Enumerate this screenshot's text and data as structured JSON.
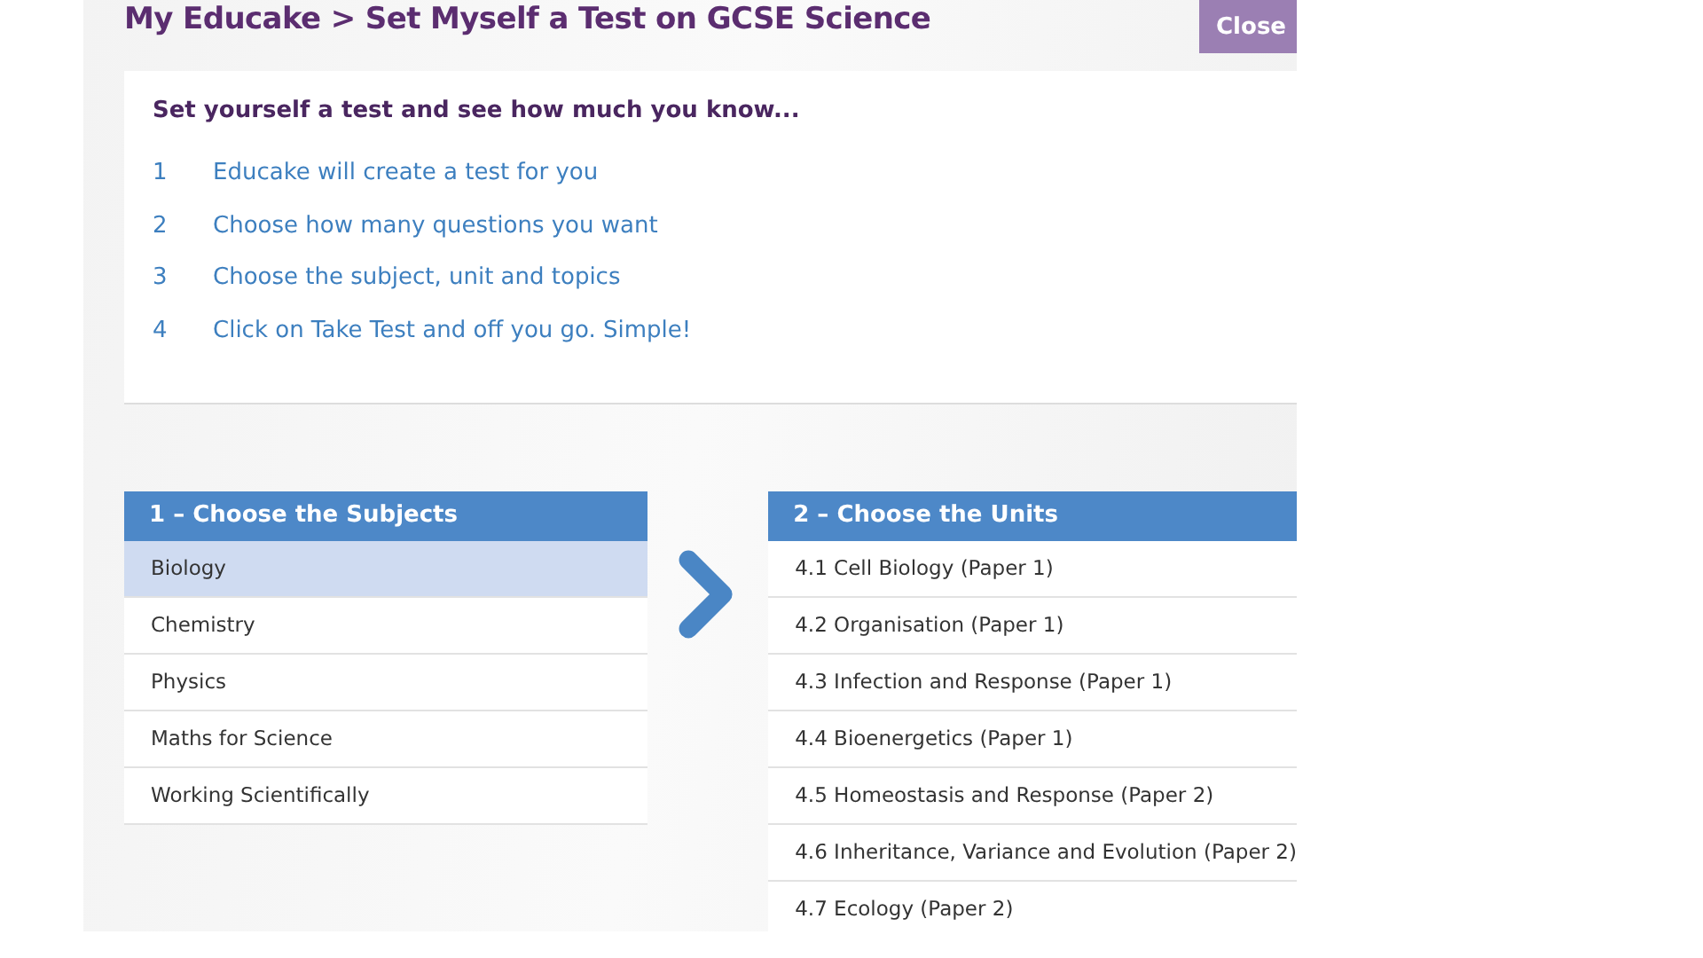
{
  "header": {
    "breadcrumb": "My Educake > Set Myself a Test on GCSE Science",
    "close_button": "Close"
  },
  "intro": {
    "heading": "Set yourself a test and see how much you know...",
    "steps": [
      {
        "number": "1",
        "text": "Educake will create a test for you"
      },
      {
        "number": "2",
        "text": "Choose how many questions you want"
      },
      {
        "number": "3",
        "text": "Choose the subject, unit and topics"
      },
      {
        "number": "4",
        "text": "Click on Take Test and off you go. Simple!"
      }
    ]
  },
  "subjects": {
    "title": "1 – Choose the Subjects",
    "items": [
      {
        "label": "Biology",
        "selected": true
      },
      {
        "label": "Chemistry",
        "selected": false
      },
      {
        "label": "Physics",
        "selected": false
      },
      {
        "label": "Maths for Science",
        "selected": false
      },
      {
        "label": "Working Scientifically",
        "selected": false
      }
    ]
  },
  "units": {
    "title": "2 – Choose the Units",
    "items": [
      {
        "label": "4.1 Cell Biology (Paper 1)",
        "selected": false
      },
      {
        "label": "4.2 Organisation (Paper 1)",
        "selected": false
      },
      {
        "label": "4.3 Infection and Response (Paper 1)",
        "selected": false
      },
      {
        "label": "4.4 Bioenergetics (Paper 1)",
        "selected": false
      },
      {
        "label": "4.5 Homeostasis and Response (Paper 2)",
        "selected": false
      },
      {
        "label": "4.6 Inheritance, Variance and Evolution (Paper 2)",
        "selected": false
      },
      {
        "label": "4.7 Ecology (Paper 2)",
        "selected": false
      }
    ]
  }
}
